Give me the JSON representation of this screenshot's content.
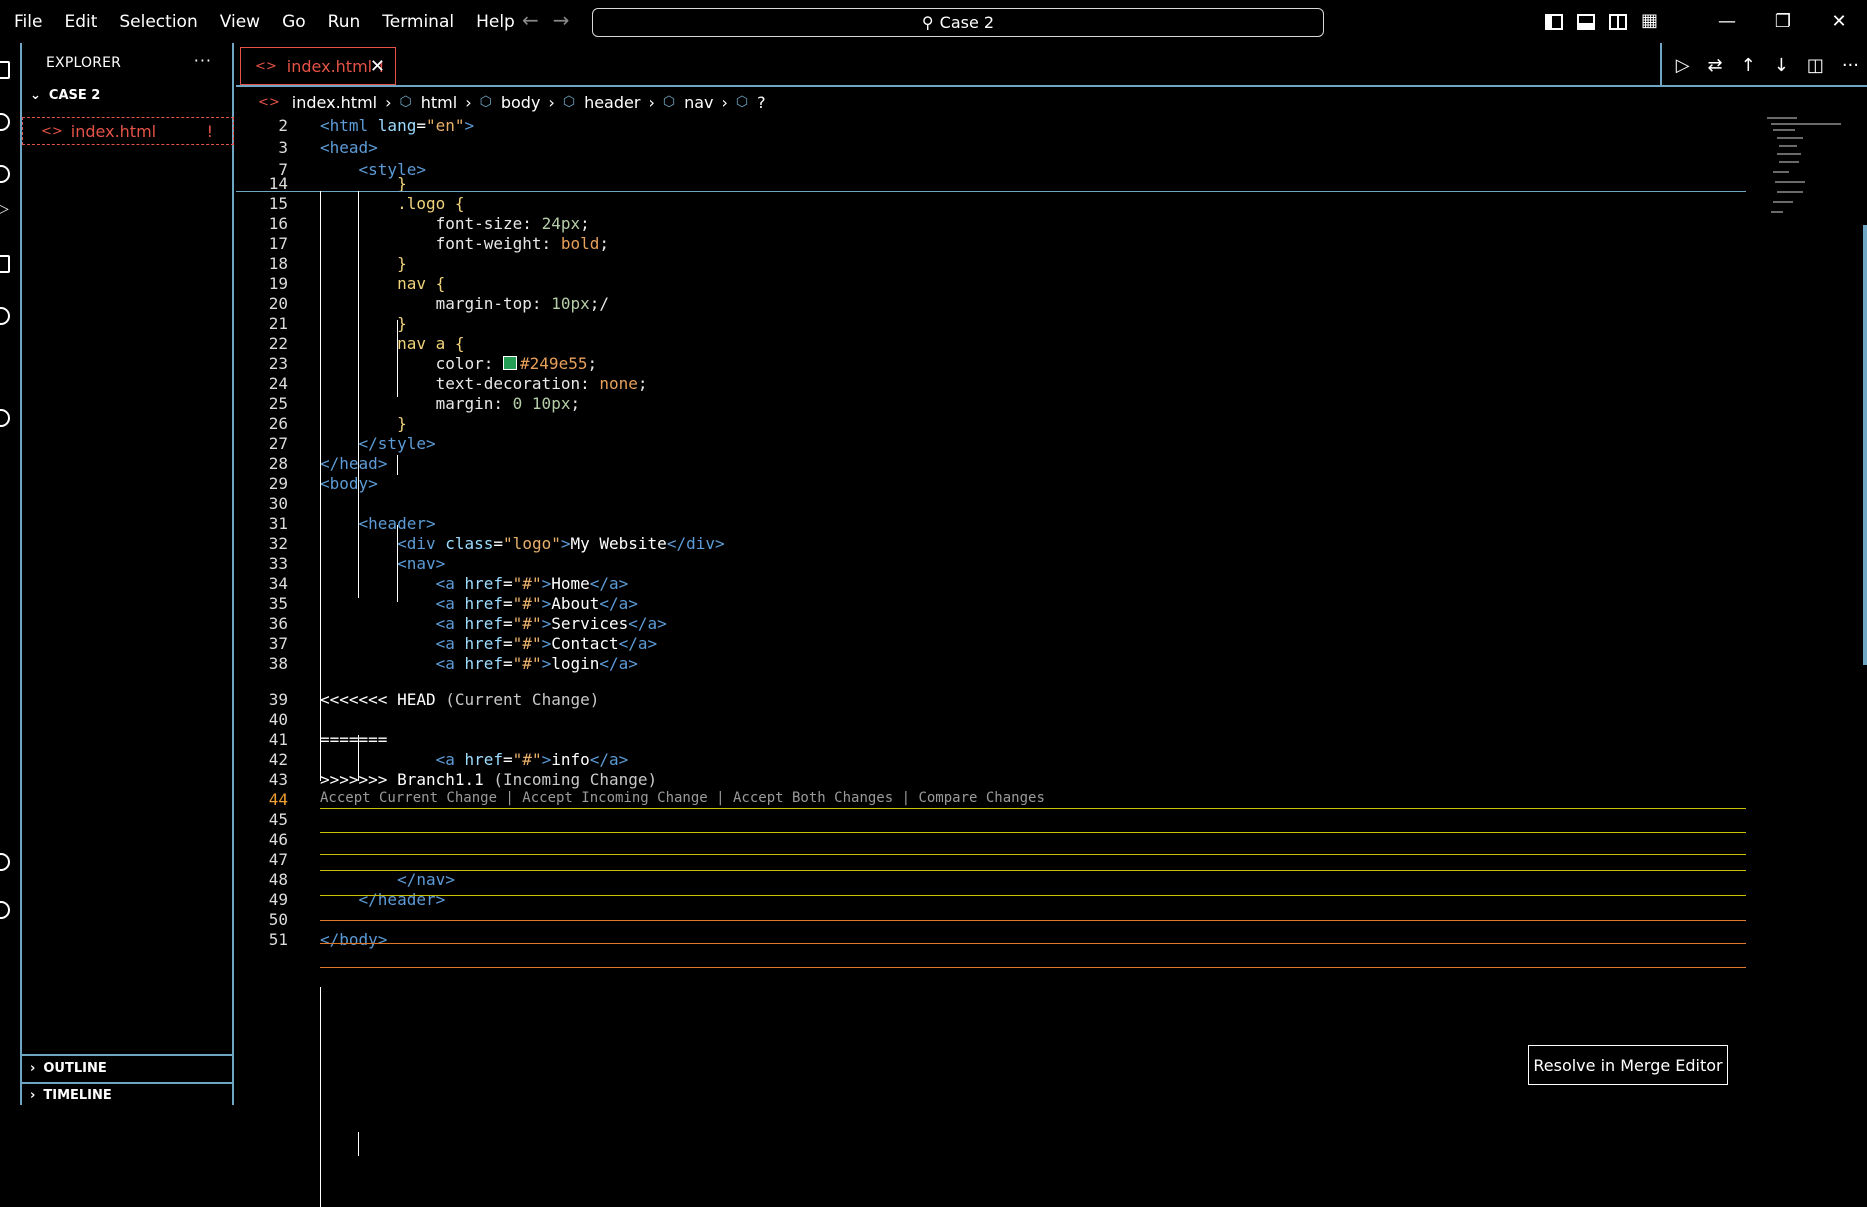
{
  "menu": [
    "File",
    "Edit",
    "Selection",
    "View",
    "Go",
    "Run",
    "Terminal",
    "Help"
  ],
  "search": {
    "text": "Case 2"
  },
  "sidebar": {
    "title": "EXPLORER",
    "more": "···",
    "folder": "CASE 2",
    "file": {
      "name": "index.html",
      "badge": "!"
    },
    "outline": "OUTLINE",
    "timeline": "TIMELINE"
  },
  "tab": {
    "label": "index.html",
    "badge": "!",
    "close": "✕"
  },
  "breadcrumb": [
    "index.html",
    "html",
    "body",
    "header",
    "nav",
    "?"
  ],
  "codelens": "Accept Current Change | Accept Incoming Change | Accept Both Changes | Compare Changes",
  "merge_button": "Resolve in Merge Editor",
  "colors": {
    "conflict_accent": "#e55347",
    "current_change": "#c8c000",
    "incoming_change": "#e07a2a",
    "focus_border": "#6fa6c4",
    "swatch": "#249e55"
  },
  "lines": [
    {
      "n": "2",
      "c": [
        [
          "t-tag",
          "<html "
        ],
        [
          "t-attr",
          "lang"
        ],
        [
          "t-txt",
          "="
        ],
        [
          "t-str",
          "\"en\""
        ],
        [
          "t-tag",
          ">"
        ]
      ]
    },
    {
      "n": "3",
      "c": [
        [
          "t-tag",
          "<head>"
        ]
      ]
    },
    {
      "n": "7",
      "c": [
        [
          "t-txt",
          "    "
        ],
        [
          "t-tag",
          "<style>"
        ]
      ]
    },
    {
      "n": "14",
      "c": [
        [
          "t-txt",
          "        "
        ],
        [
          "t-sel",
          "}"
        ]
      ]
    },
    {
      "n": "15",
      "c": [
        [
          "t-txt",
          "        "
        ],
        [
          "t-sel",
          ".logo {"
        ]
      ]
    },
    {
      "n": "16",
      "c": [
        [
          "t-txt",
          "            "
        ],
        [
          "t-prop",
          "font-size: "
        ],
        [
          "t-num",
          "24px"
        ],
        [
          "t-prop",
          ";"
        ]
      ]
    },
    {
      "n": "17",
      "c": [
        [
          "t-txt",
          "            "
        ],
        [
          "t-prop",
          "font-weight: "
        ],
        [
          "t-kw",
          "bold"
        ],
        [
          "t-prop",
          ";"
        ]
      ]
    },
    {
      "n": "18",
      "c": [
        [
          "t-txt",
          "        "
        ],
        [
          "t-sel",
          "}"
        ]
      ]
    },
    {
      "n": "19",
      "c": [
        [
          "t-txt",
          "        "
        ],
        [
          "t-sel",
          "nav {"
        ]
      ]
    },
    {
      "n": "20",
      "c": [
        [
          "t-txt",
          "            "
        ],
        [
          "t-prop",
          "margin-top: "
        ],
        [
          "t-num",
          "10px"
        ],
        [
          "t-prop",
          ";/"
        ]
      ]
    },
    {
      "n": "21",
      "c": [
        [
          "t-txt",
          "        "
        ],
        [
          "t-sel",
          "}"
        ]
      ]
    },
    {
      "n": "22",
      "c": [
        [
          "t-txt",
          "        "
        ],
        [
          "t-sel",
          "nav a {"
        ]
      ]
    },
    {
      "n": "23",
      "c": [
        [
          "t-txt",
          "            "
        ],
        [
          "t-prop",
          "color: "
        ],
        [
          "swatch",
          ""
        ],
        [
          "t-kw",
          "#249e55"
        ],
        [
          "t-prop",
          ";"
        ]
      ]
    },
    {
      "n": "24",
      "c": [
        [
          "t-txt",
          "            "
        ],
        [
          "t-prop",
          "text-decoration: "
        ],
        [
          "t-kw",
          "none"
        ],
        [
          "t-prop",
          ";"
        ]
      ]
    },
    {
      "n": "25",
      "c": [
        [
          "t-txt",
          "            "
        ],
        [
          "t-prop",
          "margin: "
        ],
        [
          "t-num",
          "0 10px"
        ],
        [
          "t-prop",
          ";"
        ]
      ]
    },
    {
      "n": "26",
      "c": [
        [
          "t-txt",
          "        "
        ],
        [
          "t-sel",
          "}"
        ]
      ]
    },
    {
      "n": "27",
      "c": [
        [
          "t-txt",
          "    "
        ],
        [
          "t-tag",
          "</style>"
        ]
      ]
    },
    {
      "n": "28",
      "c": [
        [
          "t-tag",
          "</head>"
        ]
      ]
    },
    {
      "n": "29",
      "c": [
        [
          "t-tag",
          "<body>"
        ]
      ]
    },
    {
      "n": "30",
      "c": []
    },
    {
      "n": "31",
      "c": [
        [
          "t-txt",
          "    "
        ],
        [
          "t-tag",
          "<header>"
        ]
      ]
    },
    {
      "n": "32",
      "c": [
        [
          "t-txt",
          "        "
        ],
        [
          "t-tag",
          "<div "
        ],
        [
          "t-attr",
          "class"
        ],
        [
          "t-txt",
          "="
        ],
        [
          "t-str",
          "\"logo\""
        ],
        [
          "t-tag",
          ">"
        ],
        [
          "t-txt",
          "My Website"
        ],
        [
          "t-tag",
          "</div>"
        ]
      ]
    },
    {
      "n": "33",
      "c": [
        [
          "t-txt",
          "        "
        ],
        [
          "t-tag",
          "<nav>"
        ]
      ]
    },
    {
      "n": "34",
      "c": [
        [
          "t-txt",
          "            "
        ],
        [
          "t-tag",
          "<a "
        ],
        [
          "t-attr",
          "href"
        ],
        [
          "t-txt",
          "="
        ],
        [
          "t-str",
          "\"#\""
        ],
        [
          "t-tag",
          ">"
        ],
        [
          "t-txt",
          "Home"
        ],
        [
          "t-tag",
          "</a>"
        ]
      ]
    },
    {
      "n": "35",
      "c": [
        [
          "t-txt",
          "            "
        ],
        [
          "t-tag",
          "<a "
        ],
        [
          "t-attr",
          "href"
        ],
        [
          "t-txt",
          "="
        ],
        [
          "t-str",
          "\"#\""
        ],
        [
          "t-tag",
          ">"
        ],
        [
          "t-txt",
          "About"
        ],
        [
          "t-tag",
          "</a>"
        ]
      ]
    },
    {
      "n": "36",
      "c": [
        [
          "t-txt",
          "            "
        ],
        [
          "t-tag",
          "<a "
        ],
        [
          "t-attr",
          "href"
        ],
        [
          "t-txt",
          "="
        ],
        [
          "t-str",
          "\"#\""
        ],
        [
          "t-tag",
          ">"
        ],
        [
          "t-txt",
          "Services"
        ],
        [
          "t-tag",
          "</a>"
        ]
      ]
    },
    {
      "n": "37",
      "c": [
        [
          "t-txt",
          "            "
        ],
        [
          "t-tag",
          "<a "
        ],
        [
          "t-attr",
          "href"
        ],
        [
          "t-txt",
          "="
        ],
        [
          "t-str",
          "\"#\""
        ],
        [
          "t-tag",
          ">"
        ],
        [
          "t-txt",
          "Contact"
        ],
        [
          "t-tag",
          "</a>"
        ]
      ]
    },
    {
      "n": "38",
      "c": [
        [
          "t-txt",
          "            "
        ],
        [
          "t-tag",
          "<a "
        ],
        [
          "t-attr",
          "href"
        ],
        [
          "t-txt",
          "="
        ],
        [
          "t-str",
          "\"#\""
        ],
        [
          "t-tag",
          ">"
        ],
        [
          "t-txt",
          "login"
        ],
        [
          "t-tag",
          "</a>"
        ]
      ]
    },
    {
      "n": "39",
      "c": [
        [
          "t-txt",
          "<<<<<<< HEAD "
        ],
        [
          "t-muted",
          "(Current Change)"
        ]
      ]
    },
    {
      "n": "40",
      "c": []
    },
    {
      "n": "41",
      "c": [
        [
          "t-txt",
          "======="
        ]
      ]
    },
    {
      "n": "42",
      "c": [
        [
          "t-txt",
          "            "
        ],
        [
          "t-tag",
          "<a "
        ],
        [
          "t-attr",
          "href"
        ],
        [
          "t-txt",
          "="
        ],
        [
          "t-str",
          "\"#\""
        ],
        [
          "t-tag",
          ">"
        ],
        [
          "t-txt",
          "info"
        ],
        [
          "t-tag",
          "</a>"
        ]
      ]
    },
    {
      "n": "43",
      "c": [
        [
          "t-txt",
          ">>>>>>> Branch1.1 "
        ],
        [
          "t-muted",
          "(Incoming Change)"
        ]
      ]
    },
    {
      "n": "44",
      "c": [],
      "current": true
    },
    {
      "n": "45",
      "c": []
    },
    {
      "n": "46",
      "c": []
    },
    {
      "n": "47",
      "c": []
    },
    {
      "n": "48",
      "c": [
        [
          "t-txt",
          "        "
        ],
        [
          "t-tag",
          "</nav>"
        ]
      ]
    },
    {
      "n": "49",
      "c": [
        [
          "t-txt",
          "    "
        ],
        [
          "t-tag",
          "</header>"
        ]
      ]
    },
    {
      "n": "50",
      "c": []
    },
    {
      "n": "51",
      "c": [
        [
          "t-tag",
          "</body>"
        ]
      ]
    }
  ]
}
